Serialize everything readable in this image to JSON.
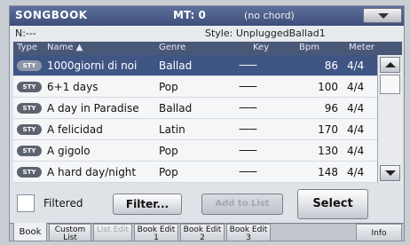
{
  "header": {
    "title": "SONGBOOK",
    "mt": "MT: 0",
    "chord": "(no chord)"
  },
  "info": {
    "n": "N:---",
    "style": "Style: UnpluggedBallad1"
  },
  "columns": [
    "Type",
    "Name ▲",
    "Genre",
    "Key",
    "Bpm",
    "Meter"
  ],
  "rows": [
    {
      "type": "STY",
      "name": "1000giorni di noi",
      "genre": "Ballad",
      "key": "------",
      "bpm": "86",
      "meter": "4/4"
    },
    {
      "type": "STY",
      "name": "6+1 days",
      "genre": "Pop",
      "key": "------",
      "bpm": "100",
      "meter": "4/4"
    },
    {
      "type": "STY",
      "name": "A day in Paradise",
      "genre": "Ballad",
      "key": "------",
      "bpm": "96",
      "meter": "4/4"
    },
    {
      "type": "STY",
      "name": "A felicidad",
      "genre": "Latin",
      "key": "------",
      "bpm": "170",
      "meter": "4/4"
    },
    {
      "type": "STY",
      "name": "A gigolo",
      "genre": "Pop",
      "key": "------",
      "bpm": "130",
      "meter": "4/4"
    },
    {
      "type": "STY",
      "name": "A hard day/night",
      "genre": "Pop",
      "key": "------",
      "bpm": "148",
      "meter": "4/4"
    }
  ],
  "controls": {
    "filtered_label": "Filtered",
    "filter_label": "Filter...",
    "add_label": "Add to List",
    "select_label": "Select"
  },
  "tabs": [
    {
      "label": "Book"
    },
    {
      "label": "Custom List"
    },
    {
      "label": "List Edit"
    },
    {
      "label": "Book Edit 1"
    },
    {
      "label": "Book Edit 2"
    },
    {
      "label": "Book Edit 3"
    },
    {
      "label": "Info"
    }
  ]
}
